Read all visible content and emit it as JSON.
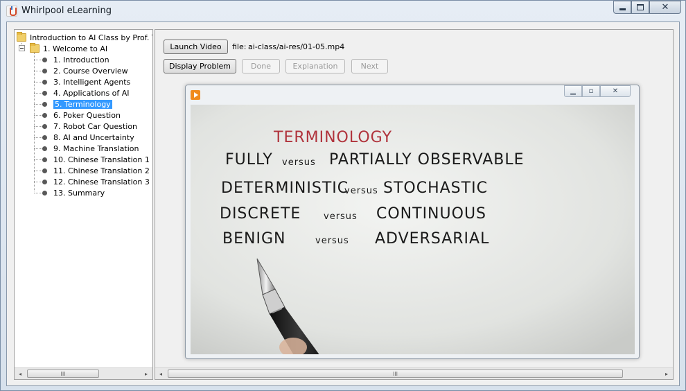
{
  "window": {
    "title": "Whirlpool eLearning"
  },
  "tree": {
    "root": "Introduction to AI Class by Prof. Thrun",
    "section": "1. Welcome to AI",
    "items": [
      "1. Introduction",
      "2. Course Overview",
      "3. Intelligent Agents",
      "4. Applications of AI",
      "5. Terminology",
      "6. Poker Question",
      "7. Robot Car Question",
      "8. AI and Uncertainty",
      "9. Machine Translation",
      "10. Chinese Translation 1",
      "11. Chinese Translation 2",
      "12. Chinese Translation 3",
      "13. Summary"
    ],
    "selected_index": 4
  },
  "toolbar": {
    "launch_video": "Launch Video",
    "file_prefix": "file:",
    "file_path": "ai-class/ai-res/01-05.mp4",
    "display_problem": "Display Problem",
    "done": "Done",
    "explanation": "Explanation",
    "next": "Next"
  },
  "video": {
    "heading": "TERMINOLOGY",
    "lines": [
      {
        "left": "FULLY",
        "middle": "versus",
        "right": "PARTIALLY OBSERVABLE"
      },
      {
        "left": "DETERMINISTIC",
        "middle": "versus",
        "right": "STOCHASTIC"
      },
      {
        "left": "DISCRETE",
        "middle": "versus",
        "right": "CONTINUOUS"
      },
      {
        "left": "BENIGN",
        "middle": "versus",
        "right": "ADVERSARIAL"
      }
    ]
  },
  "scroll": {
    "thumb_glyph": "III",
    "left_arrow": "◂",
    "right_arrow": "▸"
  },
  "colors": {
    "selection": "#3399ff",
    "heading_ink": "#b0333c",
    "ink": "#1a1a1a",
    "vlc": "#f08a1c"
  }
}
